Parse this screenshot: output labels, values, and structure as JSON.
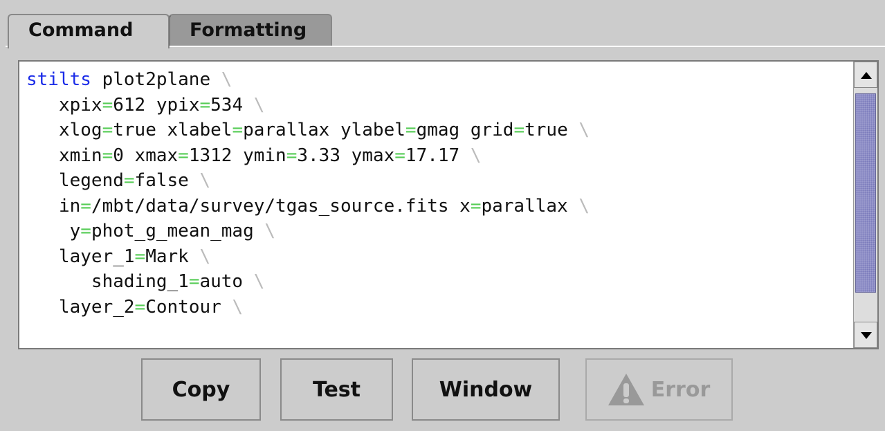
{
  "tabs": [
    {
      "label": "Command"
    },
    {
      "label": "Formatting"
    }
  ],
  "code": {
    "lines": [
      {
        "indent": "",
        "segments": [
          [
            "kw",
            "stilts"
          ],
          [
            "t",
            " plot2plane "
          ],
          [
            "bs",
            "\\"
          ]
        ]
      },
      {
        "indent": "   ",
        "segments": [
          [
            "t",
            "xpix"
          ],
          [
            "eq",
            "="
          ],
          [
            "t",
            "612 ypix"
          ],
          [
            "eq",
            "="
          ],
          [
            "t",
            "534 "
          ],
          [
            "bs",
            "\\"
          ]
        ]
      },
      {
        "indent": "   ",
        "segments": [
          [
            "t",
            "xlog"
          ],
          [
            "eq",
            "="
          ],
          [
            "t",
            "true xlabel"
          ],
          [
            "eq",
            "="
          ],
          [
            "t",
            "parallax ylabel"
          ],
          [
            "eq",
            "="
          ],
          [
            "t",
            "gmag grid"
          ],
          [
            "eq",
            "="
          ],
          [
            "t",
            "true "
          ],
          [
            "bs",
            "\\"
          ]
        ]
      },
      {
        "indent": "   ",
        "segments": [
          [
            "t",
            "xmin"
          ],
          [
            "eq",
            "="
          ],
          [
            "t",
            "0 xmax"
          ],
          [
            "eq",
            "="
          ],
          [
            "t",
            "1312 ymin"
          ],
          [
            "eq",
            "="
          ],
          [
            "t",
            "3.33 ymax"
          ],
          [
            "eq",
            "="
          ],
          [
            "t",
            "17.17 "
          ],
          [
            "bs",
            "\\"
          ]
        ]
      },
      {
        "indent": "   ",
        "segments": [
          [
            "t",
            "legend"
          ],
          [
            "eq",
            "="
          ],
          [
            "t",
            "false "
          ],
          [
            "bs",
            "\\"
          ]
        ]
      },
      {
        "indent": "   ",
        "segments": [
          [
            "t",
            "in"
          ],
          [
            "eq",
            "="
          ],
          [
            "t",
            "/mbt/data/survey/tgas_source.fits x"
          ],
          [
            "eq",
            "="
          ],
          [
            "t",
            "parallax "
          ],
          [
            "bs",
            "\\"
          ]
        ]
      },
      {
        "indent": "    ",
        "segments": [
          [
            "t",
            "y"
          ],
          [
            "eq",
            "="
          ],
          [
            "t",
            "phot_g_mean_mag "
          ],
          [
            "bs",
            "\\"
          ]
        ]
      },
      {
        "indent": "   ",
        "segments": [
          [
            "t",
            "layer_1"
          ],
          [
            "eq",
            "="
          ],
          [
            "t",
            "Mark "
          ],
          [
            "bs",
            "\\"
          ]
        ]
      },
      {
        "indent": "      ",
        "segments": [
          [
            "t",
            "shading_1"
          ],
          [
            "eq",
            "="
          ],
          [
            "t",
            "auto "
          ],
          [
            "bs",
            "\\"
          ]
        ]
      },
      {
        "indent": "   ",
        "segments": [
          [
            "t",
            "layer_2"
          ],
          [
            "eq",
            "="
          ],
          [
            "t",
            "Contour "
          ],
          [
            "bs",
            "\\"
          ]
        ]
      }
    ]
  },
  "buttons": {
    "copy": "Copy",
    "test": "Test",
    "window": "Window",
    "error": "Error"
  },
  "icons": {
    "error": "warning-triangle-icon",
    "scroll_up": "arrow-up-icon",
    "scroll_down": "arrow-down-icon"
  },
  "colors": {
    "keyword": "#1b2ce8",
    "equals": "#55cc55",
    "backslash": "#bbbbbb",
    "scroll_thumb": "#9999cc"
  }
}
